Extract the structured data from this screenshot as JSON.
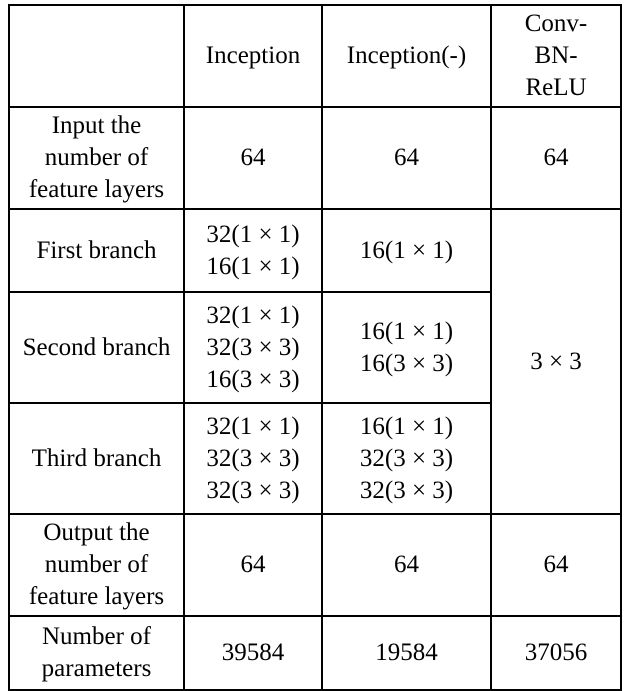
{
  "table": {
    "columns": [
      {
        "key": "label",
        "header": ""
      },
      {
        "key": "incep",
        "header": "Inception"
      },
      {
        "key": "incneg",
        "header": "Inception(-)"
      },
      {
        "key": "conv",
        "header": "Conv-BN-ReLU"
      }
    ],
    "header": {
      "corner": "",
      "inception": "Inception",
      "inception_minus": "Inception(-)",
      "conv_bn_relu_line1": "Conv-",
      "conv_bn_relu_line2": "BN-",
      "conv_bn_relu_line3": "ReLU"
    },
    "rows": [
      {
        "label_line1": "Input the",
        "label_line2": "number of",
        "label_line3": "feature layers",
        "inception": "64",
        "inception_minus": "64",
        "conv_bn_relu": "64"
      },
      {
        "label": "First branch",
        "inception_lines": [
          "32(1 × 1)",
          "16(1 × 1)"
        ],
        "inception_minus_lines": [
          "16(1 × 1)"
        ]
      },
      {
        "label": "Second branch",
        "inception_lines": [
          "32(1 × 1)",
          "32(3 × 3)",
          "16(3 × 3)"
        ],
        "inception_minus_lines": [
          "16(1 × 1)",
          "16(3 × 3)"
        ]
      },
      {
        "label": "Third branch",
        "inception_lines": [
          "32(1 × 1)",
          "32(3 × 3)",
          "32(3 × 3)"
        ],
        "inception_minus_lines": [
          "16(1 × 1)",
          "32(3 × 3)",
          "32(3 × 3)"
        ]
      },
      {
        "label_line1": "Output the",
        "label_line2": "number of",
        "label_line3": "feature layers",
        "inception": "64",
        "inception_minus": "64",
        "conv_bn_relu": "64"
      },
      {
        "label_line1": "Number of",
        "label_line2": "parameters",
        "inception": "39584",
        "inception_minus": "19584",
        "conv_bn_relu": "37056"
      }
    ],
    "merged_conv_branches": "3 × 3"
  }
}
